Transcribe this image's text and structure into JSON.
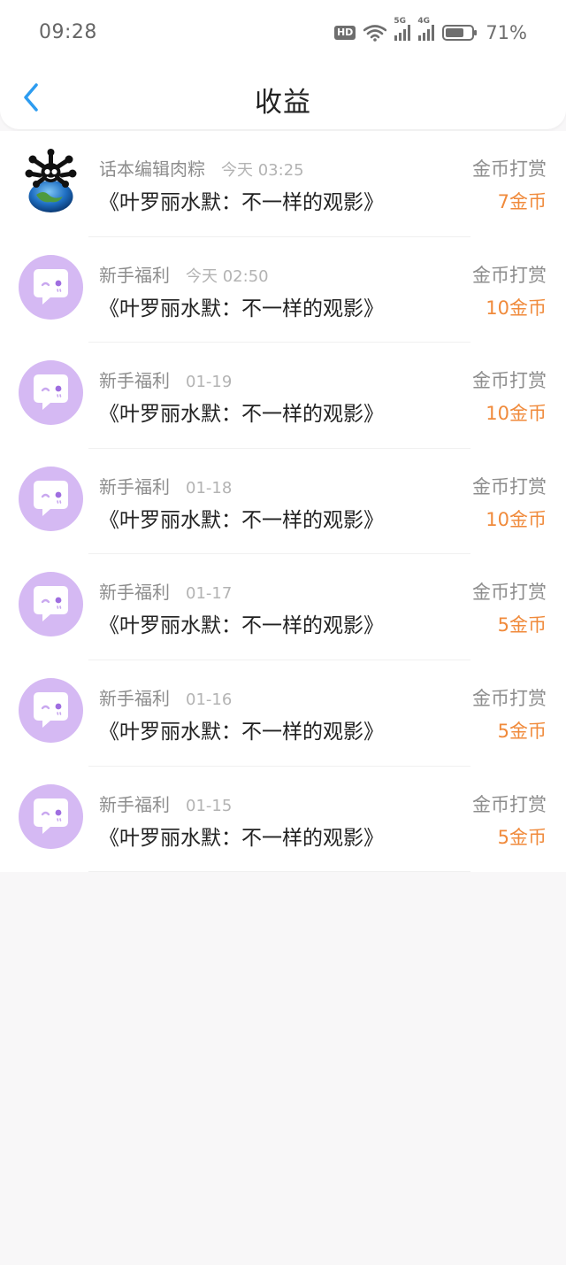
{
  "status_bar": {
    "time": "09:28",
    "hd_label": "HD",
    "network_5g_label": "5G",
    "network_4g_label": "4G",
    "battery_percent": "71%",
    "battery_level": 0.71
  },
  "header": {
    "title": "收益",
    "back_icon": "chevron-left-icon"
  },
  "colors": {
    "accent_blue": "#2d9cf0",
    "amount_orange": "#f08a3b",
    "avatar_purple": "#d5b9f3"
  },
  "earnings": [
    {
      "name": "话本编辑肉粽",
      "date": "今天 03:25",
      "work": "《叶罗丽水默：不一样的观影》",
      "type": "金币打赏",
      "amount": "7金币",
      "avatar": "photo"
    },
    {
      "name": "新手福利",
      "date": "今天 02:50",
      "work": "《叶罗丽水默：不一样的观影》",
      "type": "金币打赏",
      "amount": "10金币",
      "avatar": "chat-bubble"
    },
    {
      "name": "新手福利",
      "date": "01-19",
      "work": "《叶罗丽水默：不一样的观影》",
      "type": "金币打赏",
      "amount": "10金币",
      "avatar": "chat-bubble"
    },
    {
      "name": "新手福利",
      "date": "01-18",
      "work": "《叶罗丽水默：不一样的观影》",
      "type": "金币打赏",
      "amount": "10金币",
      "avatar": "chat-bubble"
    },
    {
      "name": "新手福利",
      "date": "01-17",
      "work": "《叶罗丽水默：不一样的观影》",
      "type": "金币打赏",
      "amount": "5金币",
      "avatar": "chat-bubble"
    },
    {
      "name": "新手福利",
      "date": "01-16",
      "work": "《叶罗丽水默：不一样的观影》",
      "type": "金币打赏",
      "amount": "5金币",
      "avatar": "chat-bubble"
    },
    {
      "name": "新手福利",
      "date": "01-15",
      "work": "《叶罗丽水默：不一样的观影》",
      "type": "金币打赏",
      "amount": "5金币",
      "avatar": "chat-bubble"
    }
  ]
}
